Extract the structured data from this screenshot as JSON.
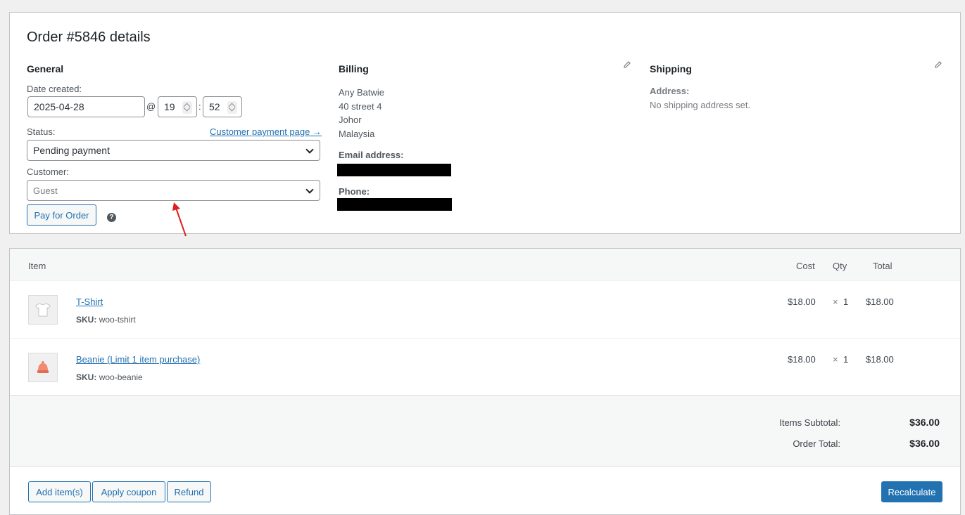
{
  "order": {
    "title": "Order #5846 details",
    "general": {
      "heading": "General",
      "date_label": "Date created:",
      "date_value": "2025-04-28",
      "at_sep": "@",
      "hour": "19",
      "time_sep": ":",
      "minute": "52",
      "status_label": "Status:",
      "payment_link": "Customer payment page →",
      "status_value": "Pending payment",
      "customer_label": "Customer:",
      "customer_placeholder": "Guest",
      "pay_button": "Pay for Order",
      "help": "?"
    },
    "billing": {
      "heading": "Billing",
      "address": [
        "Any Batwie",
        "40 street 4",
        "Johor",
        "Malaysia"
      ],
      "email_label": "Email address:",
      "phone_label": "Phone:"
    },
    "shipping": {
      "heading": "Shipping",
      "address_label": "Address:",
      "address_value": "No shipping address set."
    }
  },
  "items": {
    "headers": {
      "item": "Item",
      "cost": "Cost",
      "qty": "Qty",
      "total": "Total"
    },
    "rows": [
      {
        "name": "T-Shirt",
        "sku_label": "SKU:",
        "sku": "woo-tshirt",
        "cost": "$18.00",
        "times": "×",
        "qty": "1",
        "total": "$18.00",
        "thumb_icon": "tshirt-icon"
      },
      {
        "name": "Beanie (Limit 1 item purchase)",
        "sku_label": "SKU:",
        "sku": "woo-beanie",
        "cost": "$18.00",
        "times": "×",
        "qty": "1",
        "total": "$18.00",
        "thumb_icon": "beanie-icon"
      }
    ],
    "totals": {
      "subtotal_label": "Items Subtotal:",
      "subtotal_value": "$36.00",
      "total_label": "Order Total:",
      "total_value": "$36.00"
    },
    "actions": {
      "add_items": "Add item(s)",
      "apply_coupon": "Apply coupon",
      "refund": "Refund",
      "recalculate": "Recalculate"
    }
  },
  "colors": {
    "accent": "#2271b1",
    "annotation_arrow": "#e01e1e"
  }
}
